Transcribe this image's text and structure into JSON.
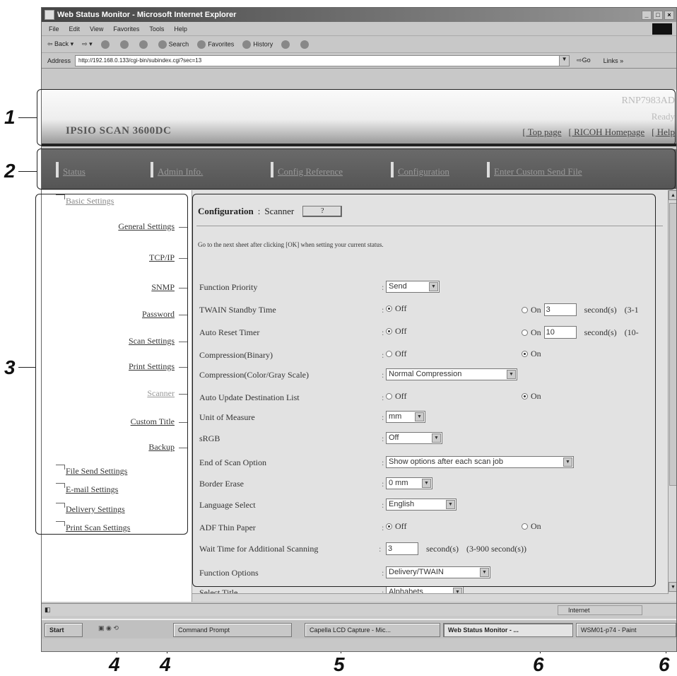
{
  "callouts": [
    "1",
    "2",
    "3",
    "4",
    "4",
    "5",
    "6",
    "6"
  ],
  "window": {
    "title": "Web Status Monitor - Microsoft Internet Explorer",
    "controls": [
      "_",
      "□",
      "×"
    ]
  },
  "menu": [
    "File",
    "Edit",
    "View",
    "Favorites",
    "Tools",
    "Help"
  ],
  "toolbar": {
    "back": "Back",
    "search": "Search",
    "favorites": "Favorites",
    "history": "History"
  },
  "address": {
    "label": "Address",
    "url": "http://192.168.0.133/cgi-bin/subindex.cgi?sec=13",
    "go": "Go",
    "links": "Links"
  },
  "header": {
    "model": "IPSIO SCAN 3600DC",
    "hostname": "RNP7983AD",
    "status": "Ready",
    "links": [
      "Top page",
      "RICOH Homepage",
      "Help"
    ]
  },
  "nav": [
    "Status",
    "Admin Info.",
    "Config Reference",
    "Configuration",
    "Enter Custom Send File"
  ],
  "sidebar": {
    "basic": "Basic Settings",
    "items": [
      "General Settings",
      "TCP/IP",
      "SNMP",
      "Password",
      "Scan Settings",
      "Print Settings",
      "Scanner",
      "Custom Title",
      "Backup"
    ],
    "groups": [
      "File Send Settings",
      "E-mail Settings",
      "Delivery Settings",
      "Print Scan Settings"
    ]
  },
  "main": {
    "heading": "Configuration",
    "subheading": "Scanner",
    "help_button": "?",
    "note": "Go to the next sheet after clicking [OK] when setting your current status.",
    "rows": [
      {
        "label": "Function Priority",
        "select": "Send"
      },
      {
        "label": "TWAIN Standby Time",
        "opt1": "Off",
        "opt2": "On",
        "value": "3",
        "unit": "second(s)",
        "range": "(3-1"
      },
      {
        "label": "Auto Reset Timer",
        "opt1": "Off",
        "opt2": "On",
        "value": "10",
        "unit": "second(s)",
        "range": "(10-"
      },
      {
        "label": "Compression(Binary)",
        "opt1": "Off",
        "opt2": "On"
      },
      {
        "label": "Compression(Color/Gray Scale)",
        "select": "Normal Compression"
      },
      {
        "label": "Auto Update Destination List",
        "opt1": "Off",
        "opt2": "On"
      },
      {
        "label": "Unit of Measure",
        "select": "mm"
      },
      {
        "label": "sRGB",
        "select": "Off"
      },
      {
        "label": "End of Scan Option",
        "select": "Show options after each scan job"
      },
      {
        "label": "Border Erase",
        "select": "0 mm"
      },
      {
        "label": "Language Select",
        "select": "English"
      },
      {
        "label": "ADF Thin Paper",
        "opt1": "Off",
        "opt2": "On"
      },
      {
        "label": "Wait Time for Additional Scanning",
        "value": "3",
        "unit": "second(s)",
        "range": "(3-900 second(s))"
      },
      {
        "label": "Function Options",
        "select": "Delivery/TWAIN"
      },
      {
        "label": "Select Title",
        "select": "Alphabets"
      }
    ]
  },
  "statusbar": {
    "zone": "Internet"
  },
  "taskbar": {
    "start": "Start",
    "buttons": [
      "Command Prompt",
      "Capella LCD Capture - Mic...",
      "Web Status Monitor - ...",
      "WSM01-p74 - Paint"
    ]
  }
}
